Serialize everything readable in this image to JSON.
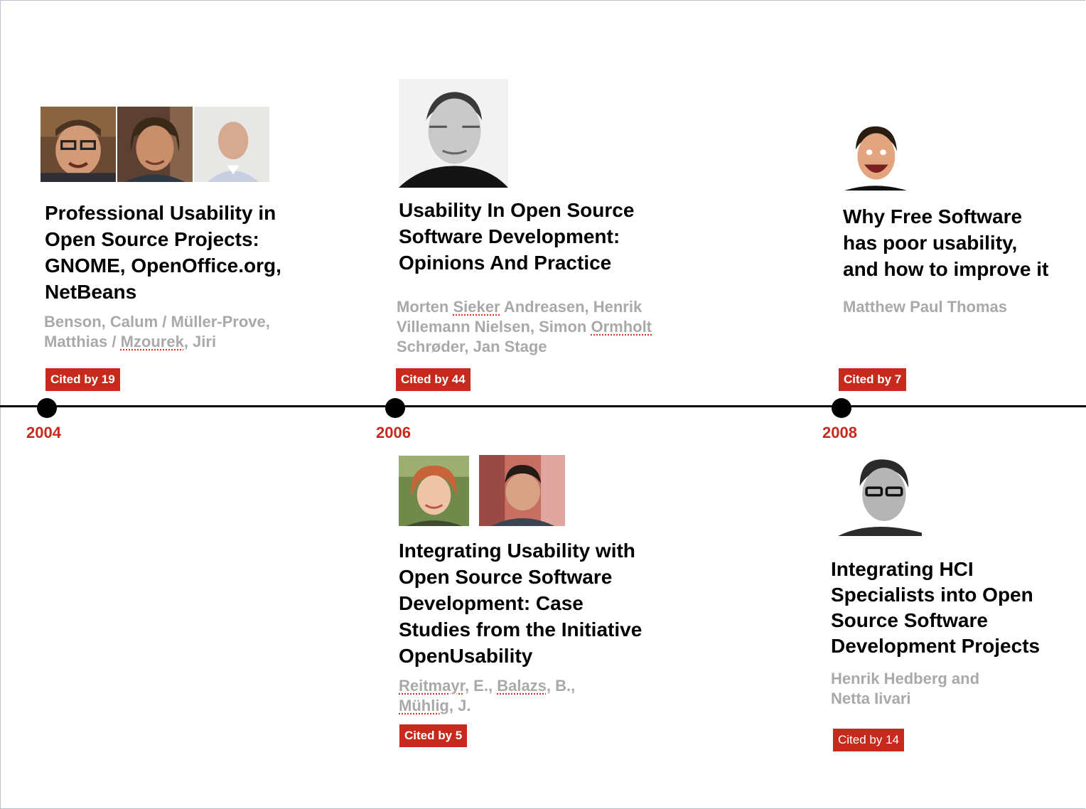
{
  "timeline": {
    "years": [
      "2004",
      "2006",
      "2008"
    ]
  },
  "papers": [
    {
      "title_lines": [
        "Professional Usability in",
        "Open Source Projects:",
        "GNOME, OpenOffice.org,",
        "NetBeans"
      ],
      "authors": [
        "Benson, Calum / Müller-Prove,",
        "Matthias / ",
        "Mzourek",
        ", Jiri"
      ],
      "cited": "Cited by 19",
      "photos": [
        "portrait-man-glasses",
        "portrait-man-long-hair",
        "portrait-man-bald"
      ]
    },
    {
      "title_lines": [
        "Usability In Open Source",
        "Software Development:",
        "Opinions And Practice"
      ],
      "authors": [
        "Morten ",
        "Sieker",
        " Andreasen, Henrik",
        "Villemann Nielsen, Simon ",
        "Ormholt",
        "Schrøder, Jan Stage"
      ],
      "cited": "Cited by 44",
      "photos": [
        "portrait-man-bw"
      ]
    },
    {
      "title_lines": [
        "Why Free Software",
        "has poor usability,",
        "and how to improve it"
      ],
      "authors": [
        "Matthew Paul Thomas"
      ],
      "cited": "Cited by 7",
      "photos": [
        "portrait-man-smiling"
      ]
    },
    {
      "title_lines": [
        "Integrating Usability with",
        "Open Source Software",
        "Development: Case",
        "Studies from the Initiative",
        "OpenUsability"
      ],
      "authors": [
        "Reitmayr",
        ", E., ",
        "Balazs",
        ", B.,",
        "Mühlig",
        ", J."
      ],
      "cited": "Cited by 5",
      "photos": [
        "portrait-woman-redhead",
        "portrait-man-dark-hair"
      ]
    },
    {
      "title_lines": [
        "Integrating HCI",
        "Specialists into Open",
        "Source Software",
        "Development Projects"
      ],
      "authors": [
        "Henrik Hedberg and",
        "Netta Iivari"
      ],
      "cited": "Cited by 14",
      "photos": [
        "portrait-man-glasses-bw"
      ]
    }
  ],
  "colors": {
    "accent": "#c72a1c",
    "authors": "#a9a9a9",
    "axis": "#000000"
  }
}
